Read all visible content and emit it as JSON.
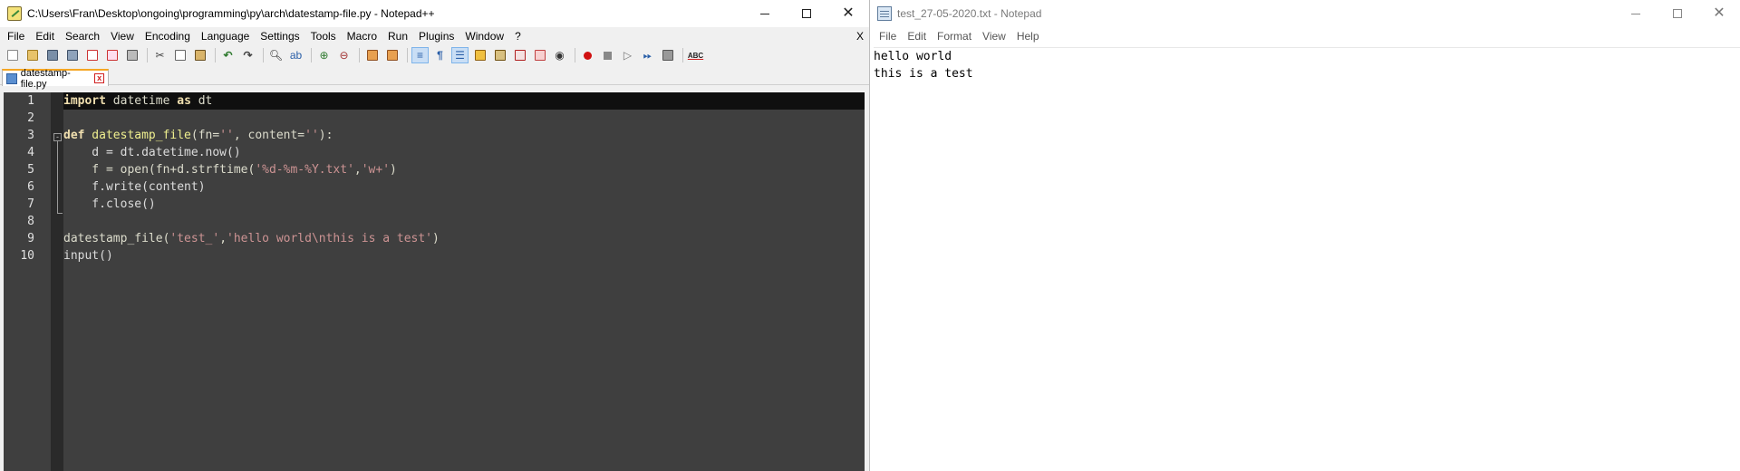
{
  "npp": {
    "title": "C:\\Users\\Fran\\Desktop\\ongoing\\programming\\py\\arch\\datestamp-file.py - Notepad++",
    "menu": [
      "File",
      "Edit",
      "Search",
      "View",
      "Encoding",
      "Language",
      "Settings",
      "Tools",
      "Macro",
      "Run",
      "Plugins",
      "Window",
      "?"
    ],
    "menu_close": "X",
    "toolbar_icons": [
      "new-file-icon",
      "open-file-icon",
      "save-icon",
      "save-all-icon",
      "close-icon",
      "close-all-icon",
      "print-icon",
      "cut-icon",
      "copy-icon",
      "paste-icon",
      "undo-icon",
      "redo-icon",
      "find-icon",
      "replace-icon",
      "zoom-in-icon",
      "zoom-out-icon",
      "sync-vertical-icon",
      "sync-horizontal-icon",
      "word-wrap-icon",
      "show-all-chars-icon",
      "indent-guide-icon",
      "udl-icon",
      "doc-map-icon",
      "function-list-icon",
      "folder-workspace-icon",
      "monitor-icon",
      "record-macro-icon",
      "stop-macro-icon",
      "play-macro-icon",
      "run-macro-multiple-icon",
      "save-macro-icon",
      "spell-check-icon"
    ],
    "spell_label": "ABC",
    "pilcrow": "¶",
    "tab": {
      "label": "datestamp-file.py",
      "close": "x"
    },
    "line_numbers": [
      "1",
      "2",
      "3",
      "4",
      "5",
      "6",
      "7",
      "8",
      "9",
      "10"
    ],
    "code": {
      "l1": {
        "kw1": "import",
        "mod": " datetime ",
        "kw2": "as",
        "alias": " dt"
      },
      "l3": {
        "kw": "def",
        "name": " datestamp_file",
        "p1": "(fn=",
        "s1": "''",
        "p2": ", content=",
        "s2": "''",
        "p3": "):"
      },
      "l4": "    d = dt.datetime.now()",
      "l5": {
        "a": "    f = open(fn+d.strftime(",
        "s1": "'%d-%m-%Y.txt'",
        "b": ",",
        "s2": "'w+'",
        "c": ")"
      },
      "l6": "    f.write(content)",
      "l7": "    f.close()",
      "l9": {
        "a": "datestamp_file(",
        "s1": "'test_'",
        "b": ",",
        "s2": "'hello world\\nthis is a test'",
        "c": ")"
      },
      "l10": "input()"
    },
    "fold_marker": "-"
  },
  "notepad": {
    "title": "test_27-05-2020.txt - Notepad",
    "menu": [
      "File",
      "Edit",
      "Format",
      "View",
      "Help"
    ],
    "lines": [
      "hello world",
      "this is a test"
    ]
  },
  "window_controls": {
    "minimize": "—",
    "maximize": "☐",
    "close": "✕"
  }
}
